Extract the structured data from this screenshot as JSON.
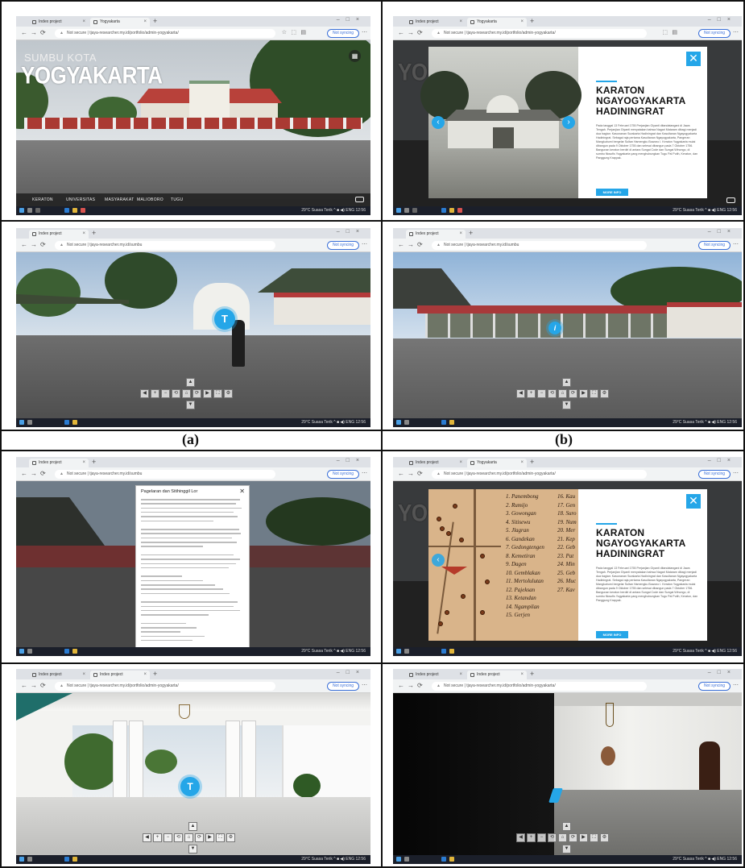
{
  "captions": {
    "a": "(a)",
    "b": "(b)"
  },
  "browser": {
    "tab_index": "Index project",
    "tab_yogyakarta": "Yogyakarta",
    "url": "tjaya-researcher.my.id/portfolio/admin-yogyakarta/",
    "url_short": "tjaya-researcher.my.id/sumbu",
    "not_secure": "Not secure",
    "paused": "Not syncing",
    "tray_text": "29°C  Suasa Terik  ^  ■ ◀) ENG  12:56"
  },
  "home": {
    "subtitle": "SUMBU KOTA",
    "title": "YOGYAKARTA",
    "nav": [
      "KERATON",
      "UNIVERSITAS",
      "MASYARAKAT",
      "MALIOBORO",
      "TUGU"
    ]
  },
  "karaton_modal": {
    "title_lines": [
      "KARATON",
      "NGAYOGYAKARTA",
      "HADININGRAT"
    ],
    "body": "Pada tanggal 13 Februari 1755 Perjanjian Giyanti ditandatangani di Jawa Tengah. Perjanjian Giyanti menyatakan bahwa Nagari Mataram dibagi menjadi dua bagian: Kasunanan Surakarta Hadiningrat dan Kasultanan Ngayogyakarta Hadiningrat. Sebagai raja pertama Kasultanan Ngayogyakarta, Pangeran Mangkubumi bergelar Sultan Hamengku Buwono I. Keraton Yogyakarta mulai dibangun pada 9 Oktober 1755 dan selesai dibangun pada 7 Oktober 1756. Bangunan keraton berdiri di antara Sungai Code dan Sungai Winongo, di sumbu filosofis Yogyakarta yang menghubungkan Tugu Pal Putih, Keraton, dan Panggung Krapyak.",
    "button": "MORE INFO",
    "close": "✕"
  },
  "popup": {
    "title": "Pagelaran dan Sitihinggil Lor",
    "close": "✕"
  },
  "map_list": [
    "1. Panembong",
    "2. Rumijo",
    "3. Gowongan",
    "4. Sitisewu",
    "5. Jlagran",
    "6. Gandekan",
    "7. Gedongtengen",
    "8. Kemetiran",
    "9. Dagen",
    "10. Gemblakan",
    "11. Mertolulutan",
    "12. Pajeksan",
    "13. Ketandan",
    "14. Ngampilan",
    "15. Gerjen"
  ],
  "map_list_right": [
    "16. Kau",
    "17. Gen",
    "18. Suro",
    "19. Num",
    "20. Mer",
    "21. Kep",
    "22. Geb",
    "23. Pat",
    "24. Min",
    "25. Geb",
    "26. Muc",
    "27. Kav"
  ],
  "hotspot": {
    "t": "T",
    "i": "i"
  },
  "controls": [
    "▲",
    "◀",
    "▶",
    "▼",
    "+",
    "−",
    "⟳",
    "⟲",
    "⛶"
  ],
  "colors": {
    "accent": "#25a6e8",
    "taskbar": "#1b1f2a"
  }
}
